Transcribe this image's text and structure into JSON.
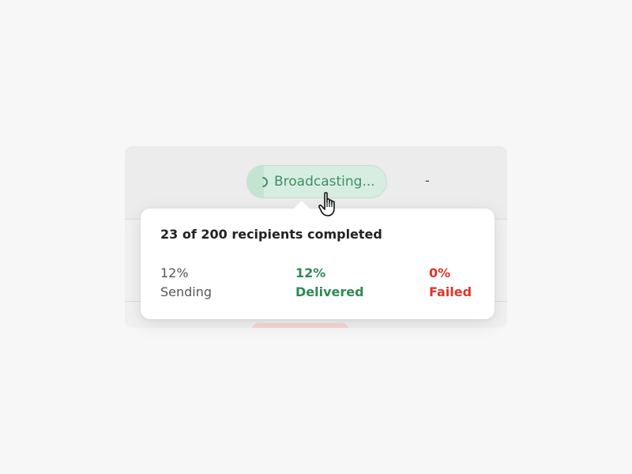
{
  "broadcast_row": {
    "status_label": "Broadcasting...",
    "trailing_value": "-",
    "progress_fraction": 0.12
  },
  "tooltip": {
    "title": "23 of 200 recipients completed",
    "stats": {
      "sending": {
        "value": "12%",
        "label": "Sending",
        "color": "#555555"
      },
      "delivered": {
        "value": "12%",
        "label": "Delivered",
        "color": "#2f8a55"
      },
      "failed": {
        "value": "0%",
        "label": "Failed",
        "color": "#e0352b"
      }
    }
  },
  "colors": {
    "status_accent": "#3e8f64",
    "status_bg": "#d8ede2",
    "failed_pill_bg": "#f7d6d6"
  },
  "icons": {
    "status": "loading-spinner-icon",
    "pointer": "hand-pointer-cursor-icon"
  }
}
